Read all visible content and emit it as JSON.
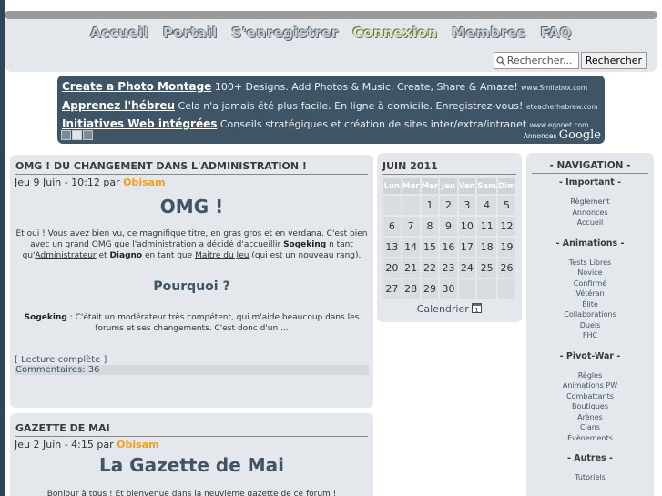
{
  "menu": {
    "items": [
      "Accueil",
      "Portail",
      "S'enregistrer",
      "Connexion",
      "Membres",
      "FAQ"
    ],
    "active": "Connexion"
  },
  "search": {
    "placeholder": "Rechercher...",
    "button": "Rechercher",
    "icon": "search-icon"
  },
  "ads": {
    "items": [
      {
        "title": "Create a Photo Montage",
        "desc": "100+ Designs. Add Photos & Music. Create, Share & Amaze!",
        "url": "www.Smilebox.com"
      },
      {
        "title": "Apprenez l'hébreu",
        "desc": "Cela n'a jamais été plus facile. En ligne à domicile. Enregistrez-vous!",
        "url": "eteacherhebrew.com"
      },
      {
        "title": "Initiatives Web intégrées",
        "desc": "Conseils stratégiques et création de sites inter/extra/intranet",
        "url": "www.egonet.com"
      }
    ],
    "choice_prefix": "Annonces",
    "choice_brand": "Google"
  },
  "articles": [
    {
      "heading": "OMG ! DU CHANGEMENT DANS L'ADMINISTRATION !",
      "date": "Jeu 9 Juin - 10:12 par",
      "author": "Obisam",
      "title": "OMG !",
      "p1_a": "Et oui ! Vous avez bien vu, ce magnifique titre, en gras gros et en verdana. C'est bien avec un grand OMG que l'administration a décidé d'accueillir",
      "p1_b": "Sogeking",
      "p1_c": "n tant qu'",
      "p1_d": "Administrateur",
      "p1_e": "et",
      "p1_f": "Diagno",
      "p1_g": "en tant que",
      "p1_h": "Maitre du Jeu",
      "p1_i": "(qui est un nouveau rang).",
      "subtitle": "Pourquoi ?",
      "p2_a": "Sogeking",
      "p2_b": ": C'était un modérateur très compétent, qui m'aide beaucoup dans les forums et ses changements. C'est donc d'un ...",
      "readmore": "[ Lecture complète ]",
      "comments": "Commentaires: 36"
    },
    {
      "heading": "GAZETTE DE MAI",
      "date": "Jeu 2 Juin - 4:15 par",
      "author": "Obisam",
      "title": "La Gazette de Mai",
      "p1": "Bonjour à tous ! Et bienvenue dans la neuvième gazette de ce forum !"
    }
  ],
  "calendar": {
    "title": "JUIN 2011",
    "days": [
      "Lun",
      "Mar",
      "Mer",
      "Jeu",
      "Ven",
      "Sam",
      "Dim"
    ],
    "weeks": [
      [
        "",
        "",
        "1",
        "2",
        "3",
        "4",
        "5"
      ],
      [
        "6",
        "7",
        "8",
        "9",
        "10",
        "11",
        "12"
      ],
      [
        "13",
        "14",
        "15",
        "16",
        "17",
        "18",
        "19"
      ],
      [
        "20",
        "21",
        "22",
        "23",
        "24",
        "25",
        "26"
      ],
      [
        "27",
        "28",
        "29",
        "30",
        "",
        "",
        ""
      ]
    ],
    "link": "Calendrier",
    "icon": "calendar-icon"
  },
  "navigation": {
    "title": "- NAVIGATION -",
    "sections": [
      {
        "title": "- Important -",
        "links": [
          "Règlement",
          "Annonces",
          "Accueil"
        ]
      },
      {
        "title": "- Animations -",
        "links": [
          "Tests Libres",
          "Novice",
          "Confirmé",
          "Vétéran",
          "Élite",
          "Collaborations",
          "Duels",
          "FHC"
        ]
      },
      {
        "title": "- Pivot-War -",
        "links": [
          "Règles",
          "Animations PW",
          "Combattants",
          "Boutiques",
          "Arènes",
          "Clans",
          "Évènements"
        ]
      },
      {
        "title": "- Autres -",
        "links": [
          "Tutoriels"
        ]
      }
    ]
  }
}
